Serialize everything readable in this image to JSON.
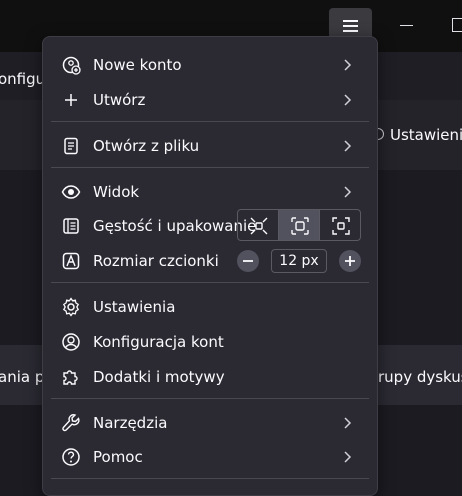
{
  "background": {
    "left_label": "onfigur",
    "right_label": "Ustawienia",
    "mid_left": "ania p",
    "mid_right": "rupy dyskus"
  },
  "menu": {
    "new_account": "Nowe konto",
    "create": "Utwórz",
    "open_file": "Otwórz z pliku",
    "view": "Widok",
    "density": "Gęstość i upakowanie",
    "font_size": "Rozmiar czcionki",
    "font_size_value": "12 px",
    "settings": "Ustawienia",
    "account_settings": "Konfiguracja kont",
    "addons": "Dodatki i motywy",
    "tools": "Narzędzia",
    "help": "Pomoc"
  },
  "density_selected": "normal",
  "colors": {
    "menu_bg": "#2b2a33",
    "selected_btn": "#52525e",
    "window_bg": "#1c1b22"
  }
}
